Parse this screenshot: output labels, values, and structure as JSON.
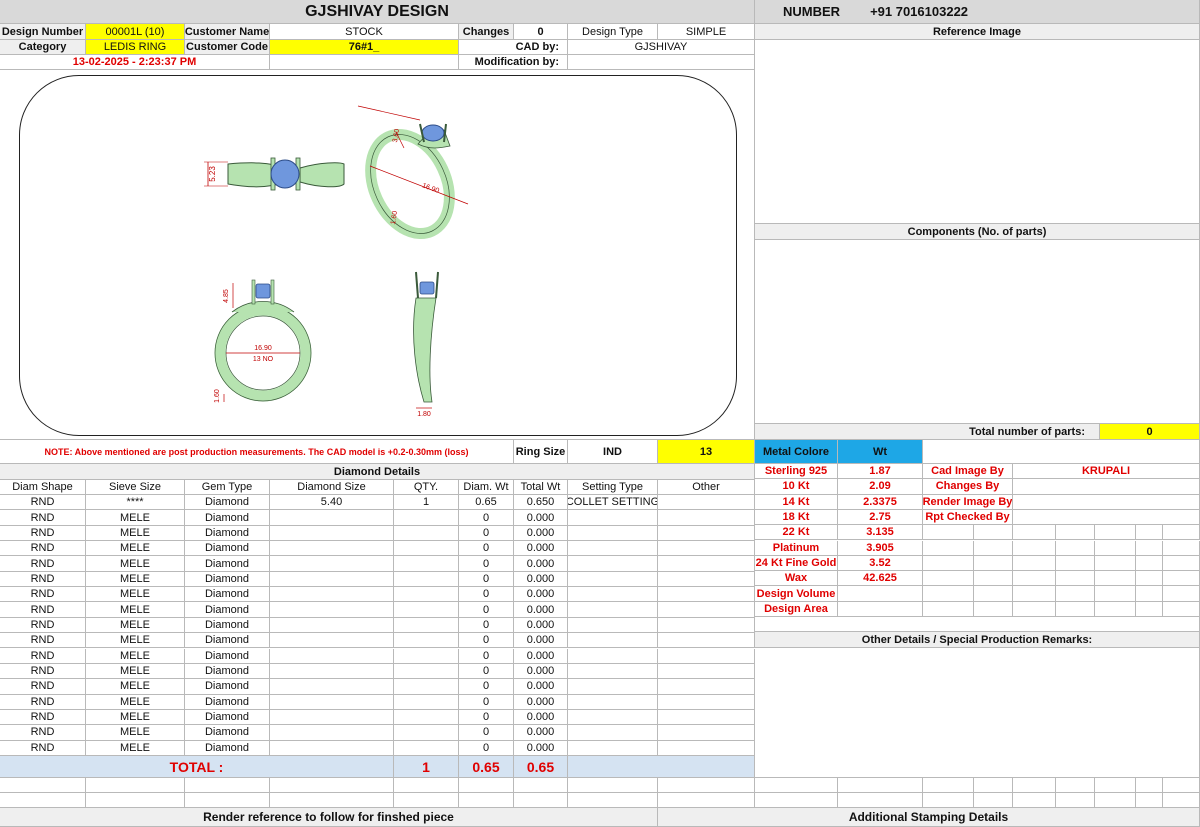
{
  "header": {
    "company": "GJSHIVAY DESIGN",
    "number_label": "NUMBER",
    "number_value": "+91 7016103222",
    "design_number_label": "Design Number",
    "design_number": "00001L (10)",
    "customer_name_label": "Customer Name",
    "customer_name": "STOCK",
    "changes_label": "Changes",
    "changes": "0",
    "design_type_label": "Design Type",
    "design_type": "SIMPLE",
    "category_label": "Category",
    "category": "LEDIS RING",
    "customer_code_label": "Customer Code",
    "customer_code": "76#1_",
    "cad_by_label": "CAD by:",
    "cad_by": "GJSHIVAY",
    "datetime": "13-02-2025 - 2:23:37 PM",
    "modification_label": "Modification by:",
    "modification": ""
  },
  "panels": {
    "reference_image": "Reference Image",
    "components": "Components (No. of parts)",
    "total_parts_label": "Total number of parts:",
    "total_parts": "0",
    "other_details": "Other Details / Special Production Remarks:",
    "render_reference": "Render reference to follow for finshed piece",
    "stamping": "Additional Stamping Details"
  },
  "drawing": {
    "dim_height_front": "5.23",
    "dim_head_top": "3.60",
    "dim_diameter_persp": "16.90",
    "dim_shank_persp": "1.60",
    "dim_head_side": "4.85",
    "dim_diameter": "16.90",
    "dim_size_label": "13 NO",
    "dim_bottom": "1.60",
    "dim_side_width": "1.80"
  },
  "note": "NOTE: Above mentioned are post production measurements. The CAD model is +0.2-0.30mm (loss)",
  "ring_size": {
    "label": "Ring Size",
    "standard": "IND",
    "value": "13"
  },
  "diamond": {
    "title": "Diamond Details",
    "headers": [
      "Diam Shape",
      "Sieve Size",
      "Gem Type",
      "Diamond Size",
      "QTY.",
      "Diam. Wt",
      "Total Wt",
      "Setting Type",
      "Other"
    ],
    "rows": [
      [
        "RND",
        "****",
        "Diamond",
        "5.40",
        "1",
        "0.65",
        "0.650",
        "COLLET SETTING",
        ""
      ],
      [
        "RND",
        "MELE",
        "Diamond",
        "",
        "",
        "0",
        "0.000",
        "",
        ""
      ],
      [
        "RND",
        "MELE",
        "Diamond",
        "",
        "",
        "0",
        "0.000",
        "",
        ""
      ],
      [
        "RND",
        "MELE",
        "Diamond",
        "",
        "",
        "0",
        "0.000",
        "",
        ""
      ],
      [
        "RND",
        "MELE",
        "Diamond",
        "",
        "",
        "0",
        "0.000",
        "",
        ""
      ],
      [
        "RND",
        "MELE",
        "Diamond",
        "",
        "",
        "0",
        "0.000",
        "",
        ""
      ],
      [
        "RND",
        "MELE",
        "Diamond",
        "",
        "",
        "0",
        "0.000",
        "",
        ""
      ],
      [
        "RND",
        "MELE",
        "Diamond",
        "",
        "",
        "0",
        "0.000",
        "",
        ""
      ],
      [
        "RND",
        "MELE",
        "Diamond",
        "",
        "",
        "0",
        "0.000",
        "",
        ""
      ],
      [
        "RND",
        "MELE",
        "Diamond",
        "",
        "",
        "0",
        "0.000",
        "",
        ""
      ],
      [
        "RND",
        "MELE",
        "Diamond",
        "",
        "",
        "0",
        "0.000",
        "",
        ""
      ],
      [
        "RND",
        "MELE",
        "Diamond",
        "",
        "",
        "0",
        "0.000",
        "",
        ""
      ],
      [
        "RND",
        "MELE",
        "Diamond",
        "",
        "",
        "0",
        "0.000",
        "",
        ""
      ],
      [
        "RND",
        "MELE",
        "Diamond",
        "",
        "",
        "0",
        "0.000",
        "",
        ""
      ],
      [
        "RND",
        "MELE",
        "Diamond",
        "",
        "",
        "0",
        "0.000",
        "",
        ""
      ],
      [
        "RND",
        "MELE",
        "Diamond",
        "",
        "",
        "0",
        "0.000",
        "",
        ""
      ],
      [
        "RND",
        "MELE",
        "Diamond",
        "",
        "",
        "0",
        "0.000",
        "",
        ""
      ]
    ],
    "total_label": "TOTAL :",
    "total_qty": "1",
    "total_diam_wt": "0.65",
    "total_wt": "0.65"
  },
  "metal": {
    "header_color": "Metal Colore",
    "header_wt": "Wt",
    "rows": [
      [
        "Sterling 925",
        "1.87"
      ],
      [
        "10 Kt",
        "2.09"
      ],
      [
        "14 Kt",
        "2.3375"
      ],
      [
        "18 Kt",
        "2.75"
      ],
      [
        "22 Kt",
        "3.135"
      ],
      [
        "Platinum",
        "3.905"
      ],
      [
        "24 Kt Fine Gold",
        "3.52"
      ],
      [
        "Wax",
        "42.625"
      ],
      [
        "Design Volume",
        ""
      ],
      [
        "Design Area",
        ""
      ]
    ]
  },
  "credits": [
    [
      "Cad Image By",
      "KRUPALI"
    ],
    [
      "Changes By",
      ""
    ],
    [
      "Render Image By",
      ""
    ],
    [
      "Rpt Checked By",
      ""
    ]
  ],
  "colors": {
    "yellow": "#ffff00",
    "metal_header": "#1ea7e6",
    "total_row": "#d5e3f2",
    "red_text": "#e00000",
    "ring": "#b6e3b0",
    "ring_outline": "#3a5a3a",
    "stone": "#6f97dd",
    "dimension": "#c00000"
  }
}
